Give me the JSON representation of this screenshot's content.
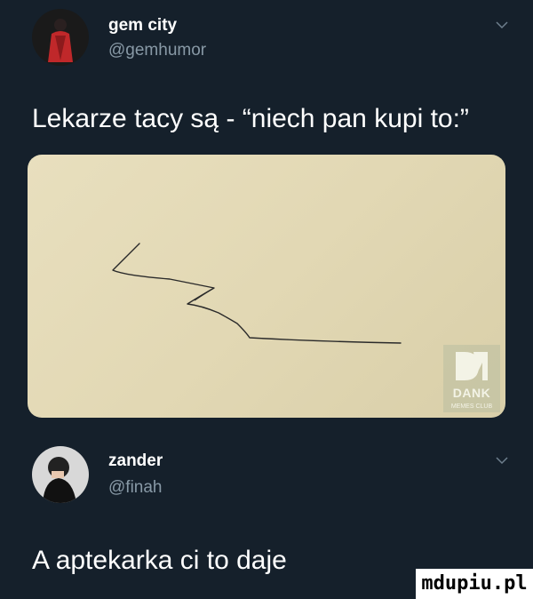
{
  "tweet1": {
    "name": "gem city",
    "handle": "@gemhumor",
    "text": "Lekarze tacy są - “niech pan kupi to:”",
    "avatar_icon": "avatar-red-dress",
    "chevron_icon": "chevron-down-icon"
  },
  "image": {
    "logo_text": "DANK",
    "logo_sub": "MEMES CLUB",
    "logo_icon": "dank-logo-icon"
  },
  "tweet2": {
    "name": "zander",
    "handle": "@finah",
    "text": "A aptekarka ci to daje",
    "avatar_icon": "avatar-person",
    "chevron_icon": "chevron-down-icon"
  },
  "watermark": "mdupiu.pl",
  "colors": {
    "background": "#15202b",
    "handle": "#8899a6",
    "paper": "#e2d8b4"
  }
}
